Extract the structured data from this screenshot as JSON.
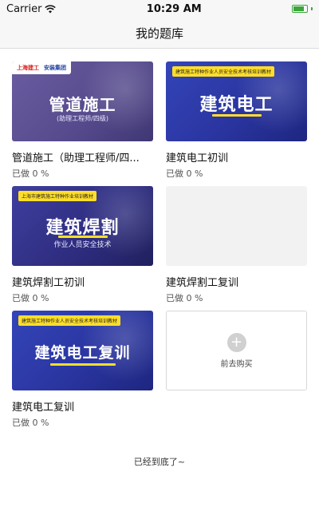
{
  "status_bar": {
    "carrier": "Carrier",
    "time": "10:29 AM",
    "battery_level": 0.85
  },
  "nav": {
    "title": "我的题库"
  },
  "courses": [
    {
      "title": "管道施工（助理工程师/四...",
      "progress": "已做 0 %",
      "thumb": {
        "brand_mark": "上海建工",
        "brand_name": "安装集团",
        "headline": "管道施工",
        "subline": "(助理工程师/四级)"
      }
    },
    {
      "title": "建筑电工初训",
      "progress": "已做 0 %",
      "thumb": {
        "tag": "建筑施工特种作业人员安全技术考核培训教材",
        "headline": "建筑电工"
      }
    },
    {
      "title": "建筑焊割工初训",
      "progress": "已做 0 %",
      "thumb": {
        "tag": "上海市建筑施工特种作业培训教材",
        "headline": "建筑焊割",
        "subline": "作业人员安全技术"
      }
    },
    {
      "title": "建筑焊割工复训",
      "progress": "已做 0 %"
    },
    {
      "title": "建筑电工复训",
      "progress": "已做 0 %",
      "thumb": {
        "tag": "建筑施工特种作业人员安全技术考核培训教材",
        "headline": "建筑电工复训"
      }
    }
  ],
  "buy_card": {
    "icon": "plus-icon",
    "label": "前去购买"
  },
  "footer": {
    "end_text": "已经到底了~"
  },
  "colors": {
    "accent_yellow": "#ffde2a",
    "battery_green": "#3aa63a",
    "thumb_blue": "#2a35a0"
  }
}
